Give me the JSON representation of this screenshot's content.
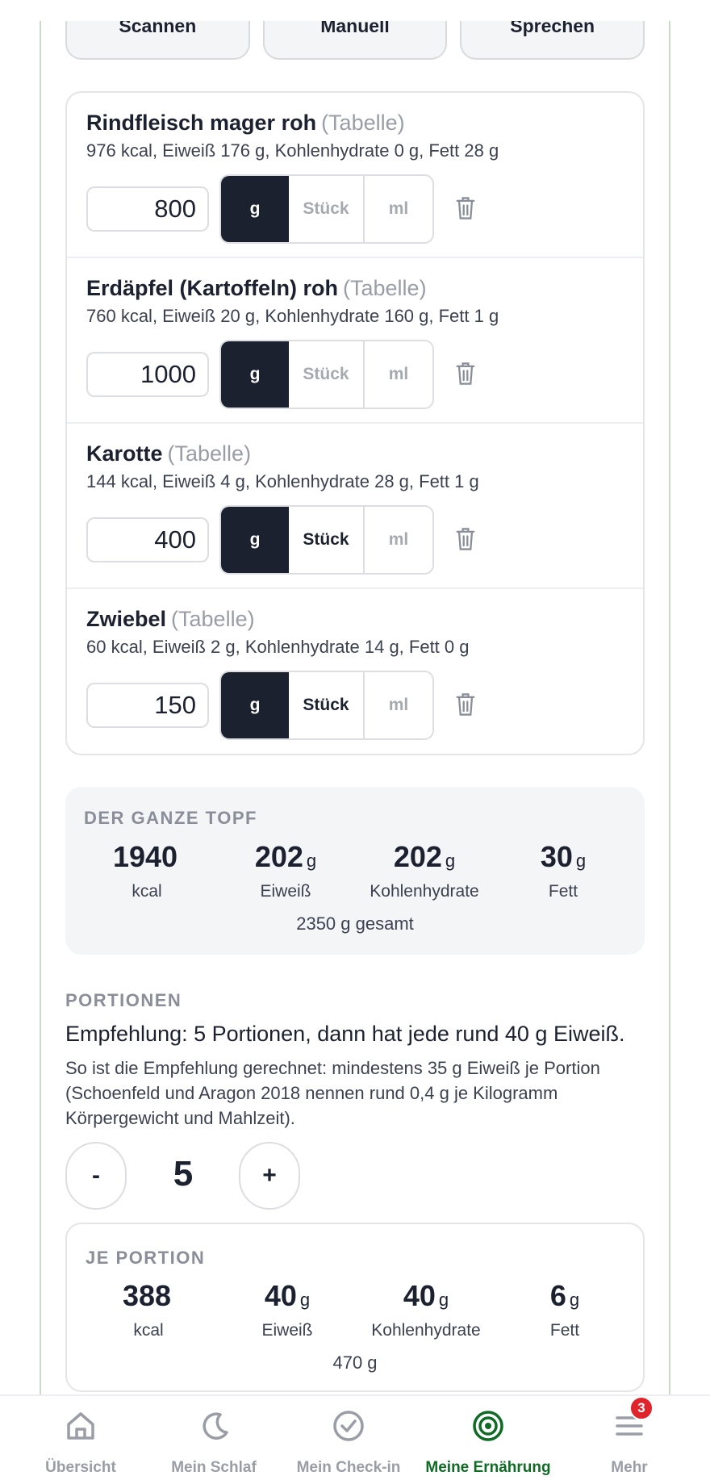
{
  "input_methods": [
    "Scannen",
    "Manuell",
    "Sprechen"
  ],
  "ingredients": [
    {
      "name": "Rindfleisch mager roh",
      "source": "(Tabelle)",
      "summary": "976 kcal, Eiweiß 176 g, Kohlenhydrate 0 g, Fett 28 g",
      "quantity": "800",
      "unit_selected": "g",
      "stueck_available": false
    },
    {
      "name": "Erdäpfel (Kartoffeln) roh",
      "source": "(Tabelle)",
      "summary": "760 kcal, Eiweiß 20 g, Kohlenhydrate 160 g, Fett 1 g",
      "quantity": "1000",
      "unit_selected": "g",
      "stueck_available": false
    },
    {
      "name": "Karotte",
      "source": "(Tabelle)",
      "summary": "144 kcal, Eiweiß 4 g, Kohlenhydrate 28 g, Fett 1 g",
      "quantity": "400",
      "unit_selected": "g",
      "stueck_available": true
    },
    {
      "name": "Zwiebel",
      "source": "(Tabelle)",
      "summary": "60 kcal, Eiweiß 2 g, Kohlenhydrate 14 g, Fett 0 g",
      "quantity": "150",
      "unit_selected": "g",
      "stueck_available": true
    }
  ],
  "units": {
    "g": "g",
    "stueck": "Stück",
    "ml": "ml"
  },
  "pot": {
    "heading": "DER GANZE TOPF",
    "stats": [
      {
        "value": "1940",
        "unit": "",
        "label": "kcal"
      },
      {
        "value": "202",
        "unit": "g",
        "label": "Eiweiß"
      },
      {
        "value": "202",
        "unit": "g",
        "label": "Kohlenhydrate"
      },
      {
        "value": "30",
        "unit": "g",
        "label": "Fett"
      }
    ],
    "total": "2350 g gesamt"
  },
  "portions": {
    "heading": "PORTIONEN",
    "recommendation": "Empfehlung: 5 Portionen, dann hat jede rund 40 g Eiweiß.",
    "explanation": "So ist die Empfehlung gerechnet: mindestens 35 g Eiweiß je Portion (Schoenfeld und Aragon 2018 nennen rund 0,4 g je Kilogramm Körpergewicht und Mahlzeit).",
    "minus_label": "-",
    "plus_label": "+",
    "count": "5"
  },
  "per_portion": {
    "heading": "JE PORTION",
    "stats": [
      {
        "value": "388",
        "unit": "",
        "label": "kcal"
      },
      {
        "value": "40",
        "unit": "g",
        "label": "Eiweiß"
      },
      {
        "value": "40",
        "unit": "g",
        "label": "Kohlenhydrate"
      },
      {
        "value": "6",
        "unit": "g",
        "label": "Fett"
      }
    ],
    "total": "470 g"
  },
  "nav": {
    "items": [
      {
        "label": "Übersicht",
        "icon": "home-icon"
      },
      {
        "label": "Mein Schlaf",
        "icon": "moon-icon"
      },
      {
        "label": "Mein Check-in",
        "icon": "check-circle-icon"
      },
      {
        "label": "Meine Ernährung",
        "icon": "target-icon"
      },
      {
        "label": "Mehr",
        "icon": "menu-icon"
      }
    ],
    "active_index": 3,
    "badge_count": "3"
  },
  "colors": {
    "accent_dark": "#1c2130",
    "nav_active": "#0f6b24",
    "badge": "#e0242b"
  }
}
